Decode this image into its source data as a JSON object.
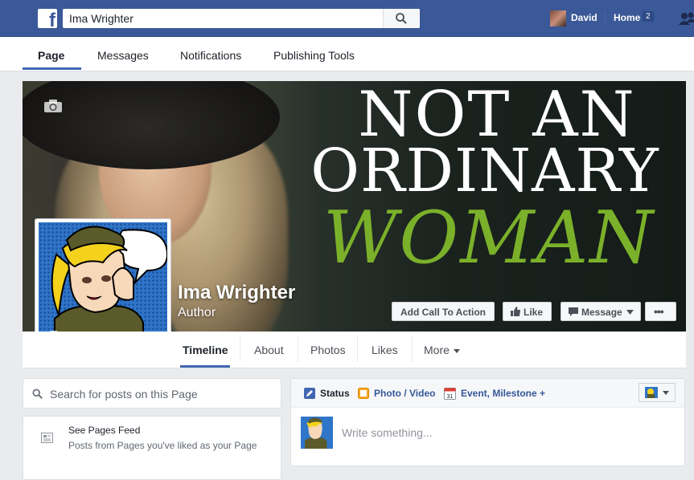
{
  "topbar": {
    "search_value": "Ima Wrighter",
    "user_name": "David",
    "home_label": "Home",
    "home_count": "2",
    "logo_letter": "f",
    "bg_color": "#3b5998"
  },
  "page_tabs": [
    "Page",
    "Messages",
    "Notifications",
    "Publishing Tools"
  ],
  "cover": {
    "line1": "NOT AN",
    "line2": "ORDINARY",
    "line3": "WOMAN"
  },
  "profile": {
    "name": "Ima Wrighter",
    "category": "Author"
  },
  "actions": {
    "cta": "Add Call To Action",
    "like": "Like",
    "message": "Message",
    "more": "•••"
  },
  "timeline_tabs": [
    "Timeline",
    "About",
    "Photos",
    "Likes",
    "More"
  ],
  "left": {
    "search_placeholder": "Search for posts on this Page",
    "feed_title": "See Pages Feed",
    "feed_subtitle": "Posts from Pages you've liked as your Page"
  },
  "composer": {
    "status": "Status",
    "photo_video": "Photo / Video",
    "event": "Event, Milestone +",
    "write_placeholder": "Write something...",
    "calendar_day": "31"
  },
  "icons": [
    "facebook-logo-icon",
    "search-icon",
    "friends-icon",
    "camera-icon",
    "thumbs-up-icon",
    "message-icon",
    "chevron-down-icon",
    "feed-icon",
    "pencil-icon",
    "photo-icon",
    "calendar-icon"
  ]
}
